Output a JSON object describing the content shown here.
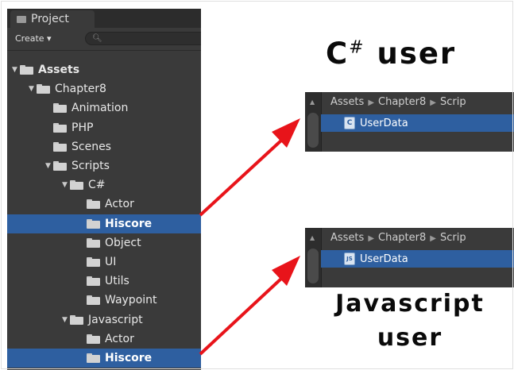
{
  "project_panel": {
    "tab_label": "Project",
    "create_label": "Create ▾",
    "search_icon": "search-icon",
    "tree": [
      {
        "label": "Assets",
        "expanded": true,
        "bold": true,
        "selected": false
      },
      {
        "label": "Chapter8",
        "expanded": true,
        "bold": false,
        "selected": false
      },
      {
        "label": "Animation",
        "expanded": false,
        "bold": false,
        "selected": false
      },
      {
        "label": "PHP",
        "expanded": false,
        "bold": false,
        "selected": false
      },
      {
        "label": "Scenes",
        "expanded": false,
        "bold": false,
        "selected": false
      },
      {
        "label": "Scripts",
        "expanded": true,
        "bold": false,
        "selected": false
      },
      {
        "label": "C#",
        "expanded": true,
        "bold": false,
        "selected": false
      },
      {
        "label": "Actor",
        "expanded": false,
        "bold": false,
        "selected": false
      },
      {
        "label": "Hiscore",
        "expanded": false,
        "bold": true,
        "selected": true
      },
      {
        "label": "Object",
        "expanded": false,
        "bold": false,
        "selected": false
      },
      {
        "label": "UI",
        "expanded": false,
        "bold": false,
        "selected": false
      },
      {
        "label": "Utils",
        "expanded": false,
        "bold": false,
        "selected": false
      },
      {
        "label": "Waypoint",
        "expanded": false,
        "bold": false,
        "selected": false
      },
      {
        "label": "Javascript",
        "expanded": true,
        "bold": false,
        "selected": false
      },
      {
        "label": "Actor",
        "expanded": false,
        "bold": false,
        "selected": false
      },
      {
        "label": "Hiscore",
        "expanded": false,
        "bold": true,
        "selected": true
      }
    ]
  },
  "csharp_section": {
    "heading_main": "C",
    "heading_sup": "#",
    "heading_rest": " user",
    "breadcrumb": [
      "Assets",
      "Chapter8",
      "Scrip"
    ],
    "file_icon_glyph": "C",
    "file_label": "UserData"
  },
  "javascript_section": {
    "heading_line1": "Javascript",
    "heading_line2": "user",
    "breadcrumb": [
      "Assets",
      "Chapter8",
      "Scrip"
    ],
    "file_icon_glyph": "JS",
    "file_label": "UserData"
  },
  "colors": {
    "panel_bg": "#3a3a3a",
    "selection": "#2e5fa0",
    "arrow": "#e8141a"
  }
}
